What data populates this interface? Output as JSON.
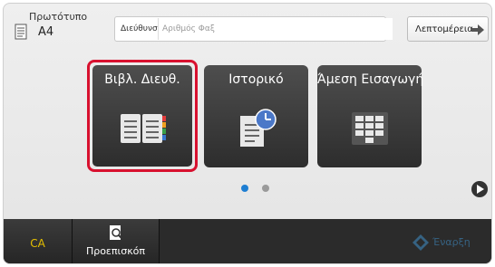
{
  "header": {
    "original_label": "Πρωτότυπο",
    "original_size": "A4",
    "address_label": "Διεύθυνση",
    "address_placeholder": "Αριθμός Φαξ",
    "details_label": "Λεπτομέρεια"
  },
  "tiles": [
    {
      "label": "Βιβλ. Διευθ.",
      "icon": "address-book-icon",
      "selected": true
    },
    {
      "label": "Ιστορικό",
      "icon": "history-icon",
      "selected": false
    },
    {
      "label": "Άμεση Εισαγωγή",
      "icon": "keypad-icon",
      "selected": false
    }
  ],
  "pager": {
    "current_page": 1,
    "total_pages": 2
  },
  "footer": {
    "ca_label": "CA",
    "preview_label": "Προεπισκόπ",
    "start_label": "Έναρξη"
  },
  "colors": {
    "selection_border": "#d8112f",
    "ca_text": "#e6c000",
    "active_dot": "#1e7ed2",
    "start_text": "#3f8fc9"
  }
}
